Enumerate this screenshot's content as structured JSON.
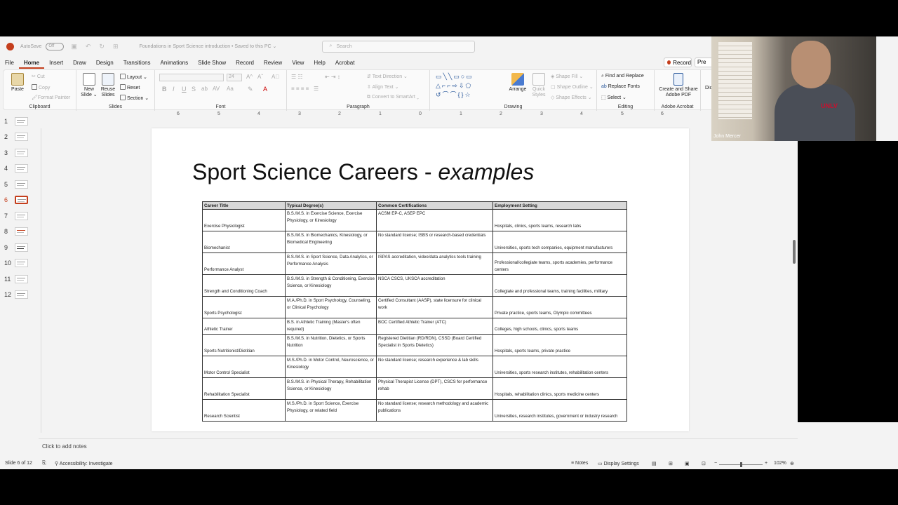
{
  "titlebar": {
    "autosave_label": "AutoSave",
    "autosave_state": "Off",
    "document_title": "Foundations in Sport Science introduction • Saved to this PC ⌄",
    "search_placeholder": "Search"
  },
  "tabs": [
    "File",
    "Home",
    "Insert",
    "Draw",
    "Design",
    "Transitions",
    "Animations",
    "Slide Show",
    "Record",
    "Review",
    "View",
    "Help",
    "Acrobat"
  ],
  "active_tab": "Home",
  "record_button": "Record",
  "present_button": "Pre",
  "ribbon": {
    "clipboard": {
      "paste": "Paste",
      "cut": "Cut",
      "copy": "Copy",
      "format_painter": "Format Painter",
      "label": "Clipboard"
    },
    "slides": {
      "new_slide": "New Slide ⌄",
      "reuse_slides": "Reuse Slides",
      "layout": "Layout ⌄",
      "reset": "Reset",
      "section": "Section ⌄",
      "label": "Slides"
    },
    "font": {
      "size": "24",
      "label": "Font"
    },
    "paragraph": {
      "text_direction": "Text Direction ⌄",
      "align_text": "Align Text ⌄",
      "convert_smartart": "Convert to SmartArt ⌄",
      "label": "Paragraph"
    },
    "drawing": {
      "arrange": "Arrange",
      "quick_styles": "Quick Styles",
      "shape_fill": "Shape Fill ⌄",
      "shape_outline": "Shape Outline ⌄",
      "shape_effects": "Shape Effects ⌄",
      "label": "Drawing"
    },
    "editing": {
      "find_replace": "Find and Replace",
      "replace_fonts": "Replace Fonts",
      "select": "Select ⌄",
      "label": "Editing"
    },
    "acrobat": {
      "create_share": "Create and Share Adobe PDF",
      "label": "Adobe Acrobat",
      "extra": "Dic"
    }
  },
  "ruler_marks": [
    "6",
    "5",
    "4",
    "3",
    "2",
    "1",
    "0",
    "1",
    "2",
    "3",
    "4",
    "5",
    "6"
  ],
  "slide_count": [
    "1",
    "2",
    "3",
    "4",
    "5",
    "6",
    "7",
    "8",
    "9",
    "10",
    "11",
    "12"
  ],
  "active_slide_index": 5,
  "slide": {
    "title_main": "Sport Science Careers - ",
    "title_italic": "examples",
    "table": {
      "headers": [
        "Career Title",
        "Typical Degree(s)",
        "Common Certifications",
        "Employment Setting"
      ],
      "rows": [
        [
          "Exercise Physiologist",
          "B.S./M.S. in Exercise Science, Exercise Physiology, or Kinesiology",
          "ACSM EP-C, ASEP EPC",
          "Hospitals, clinics, sports teams, research labs"
        ],
        [
          "Biomechanist",
          "B.S./M.S. in Biomechanics, Kinesiology, or Biomedical Engineering",
          "No standard license; ISBS or research-based credentials",
          "Universities, sports tech companies, equipment manufacturers"
        ],
        [
          "Performance Analyst",
          "B.S./M.S. in Sport Science, Data Analytics, or Performance Analysis",
          "ISPAS accreditation, video/data analytics tools training",
          "Professional/collegiate teams, sports academies, performance centers"
        ],
        [
          "Strength and Conditioning Coach",
          "B.S./M.S. in Strength & Conditioning, Exercise Science, or Kinesiology",
          "NSCA CSCS, UKSCA accreditation",
          "Collegiate and professional teams, training facilities, military"
        ],
        [
          "Sports Psychologist",
          "M.A./Ph.D. in Sport Psychology, Counseling, or Clinical Psychology",
          "Certified Consultant (AASP), state licensure for clinical work",
          "Private practice, sports teams, Olympic committees"
        ],
        [
          "Athletic Trainer",
          "B.S. in Athletic Training (Master's often required)",
          "BOC Certified Athletic Trainer (ATC)",
          "Colleges, high schools, clinics, sports teams"
        ],
        [
          "Sports Nutritionist/Dietitian",
          "B.S./M.S. in Nutrition, Dietetics, or Sports Nutrition",
          "Registered Dietitian (RD/RDN), CSSD (Board Certified Specialist in Sports Dietetics)",
          "Hospitals, sports teams, private practice"
        ],
        [
          "Motor Control Specialist",
          "M.S./Ph.D. in Motor Control, Neuroscience, or Kinesiology",
          "No standard license; research experience & lab skills",
          "Universities, sports research institutes, rehabilitation centers"
        ],
        [
          "Rehabilitation Specialist",
          "B.S./M.S. in Physical Therapy, Rehabilitation Science, or Kinesiology",
          "Physical Therapist License (DPT), CSCS for performance rehab",
          "Hospitals, rehabilitation clinics, sports medicine centers"
        ],
        [
          "Research Scientist",
          "M.S./Ph.D. in Sport Science, Exercise Physiology, or related field",
          "No standard license; research methodology and academic publications",
          "Universities, research institutes, government or industry research"
        ]
      ]
    }
  },
  "notes_placeholder": "Click to add notes",
  "status": {
    "slide_of": "Slide 6 of 12",
    "accessibility": "Accessibility: Investigate",
    "notes": "Notes",
    "display_settings": "Display Settings",
    "zoom": "102%"
  },
  "webcam": {
    "name": "John Mercer",
    "shirt_logo": "UNLV"
  },
  "colors": {
    "accent": "#c43e1c",
    "header_fill": "#d9d9d9"
  }
}
